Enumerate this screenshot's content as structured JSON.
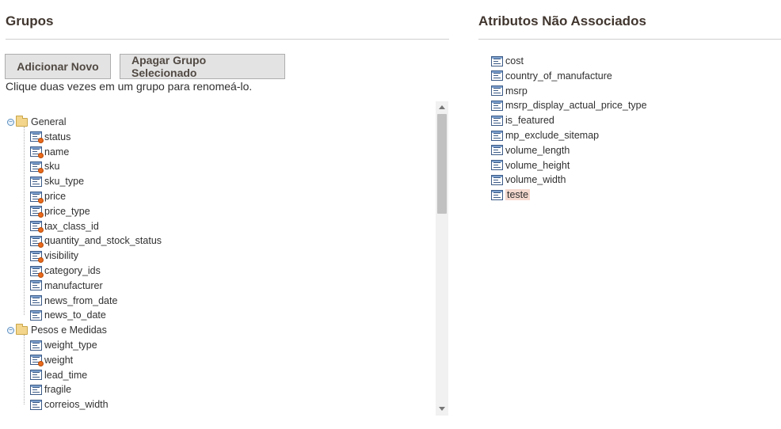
{
  "groups_panel": {
    "title": "Grupos",
    "add_button": "Adicionar Novo",
    "delete_button": "Apagar Grupo Selecionado",
    "hint": "Clique duas vezes em um grupo para renomeá-lo."
  },
  "tree": [
    {
      "name": "General",
      "expanded": true,
      "attributes": [
        {
          "name": "status",
          "system": true
        },
        {
          "name": "name",
          "system": true
        },
        {
          "name": "sku",
          "system": true
        },
        {
          "name": "sku_type",
          "system": false
        },
        {
          "name": "price",
          "system": true
        },
        {
          "name": "price_type",
          "system": true
        },
        {
          "name": "tax_class_id",
          "system": true
        },
        {
          "name": "quantity_and_stock_status",
          "system": true
        },
        {
          "name": "visibility",
          "system": true
        },
        {
          "name": "category_ids",
          "system": true
        },
        {
          "name": "manufacturer",
          "system": false
        },
        {
          "name": "news_from_date",
          "system": false
        },
        {
          "name": "news_to_date",
          "system": false
        }
      ]
    },
    {
      "name": "Pesos e Medidas",
      "expanded": true,
      "attributes": [
        {
          "name": "weight_type",
          "system": false
        },
        {
          "name": "weight",
          "system": true
        },
        {
          "name": "lead_time",
          "system": false
        },
        {
          "name": "fragile",
          "system": false
        },
        {
          "name": "correios_width",
          "system": false
        }
      ]
    }
  ],
  "unassigned_panel": {
    "title": "Atributos Não Associados",
    "attributes": [
      {
        "name": "cost",
        "selected": false
      },
      {
        "name": "country_of_manufacture",
        "selected": false
      },
      {
        "name": "msrp",
        "selected": false
      },
      {
        "name": "msrp_display_actual_price_type",
        "selected": false
      },
      {
        "name": "is_featured",
        "selected": false
      },
      {
        "name": "mp_exclude_sitemap",
        "selected": false
      },
      {
        "name": "volume_length",
        "selected": false
      },
      {
        "name": "volume_height",
        "selected": false
      },
      {
        "name": "volume_width",
        "selected": false
      },
      {
        "name": "teste",
        "selected": true
      }
    ]
  },
  "colors": {
    "title": "#41362f",
    "button_bg": "#e3e3e3",
    "selected_highlight": "#f5d9cf",
    "icon_border": "#3b5a86",
    "system_badge": "#e86a1c"
  }
}
